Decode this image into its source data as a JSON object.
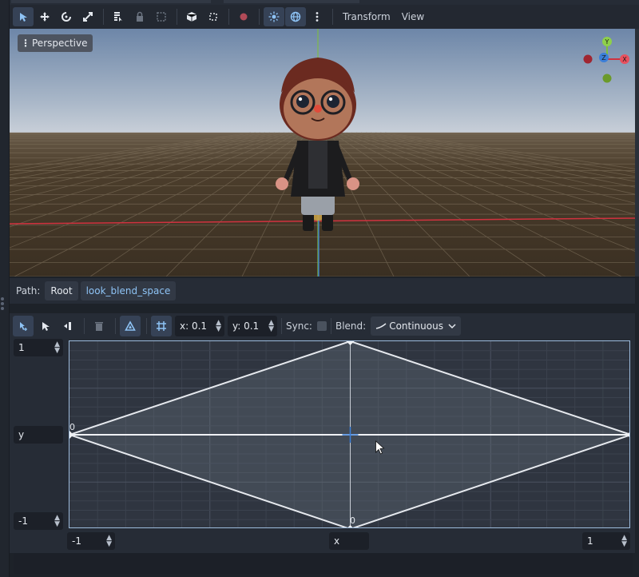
{
  "toolbar": {
    "icons": [
      "select-icon",
      "move-icon",
      "rotate-icon",
      "scale-icon",
      "list-select-icon",
      "lock-icon",
      "group-icon",
      "cube-icon",
      "ruler-icon",
      "pin-icon",
      "sun-icon",
      "globe-icon",
      "more-icon"
    ],
    "transform_menu": "Transform",
    "view_menu": "View"
  },
  "viewport": {
    "perspective_label": "Perspective",
    "gizmo": {
      "y": "Y",
      "z": "Z",
      "x": "X"
    },
    "colors": {
      "sky_top": "#6d86a8",
      "sky_horizon": "#c8cfd8",
      "ground": "#3a2f22",
      "x_axis": "#d0323f",
      "y_axis": "#7fbf3a",
      "z_axis": "#3b7fd9"
    }
  },
  "path_bar": {
    "label": "Path:",
    "items": [
      "Root",
      "look_blend_space"
    ]
  },
  "blend_toolbar": {
    "icons": [
      "create-point-icon",
      "select-icon",
      "add-point-icon",
      "delete-icon",
      "triangle-icon",
      "snap-grid-icon"
    ],
    "x_snap": "x: 0.1",
    "y_snap": "y: 0.1",
    "sync_label": "Sync:",
    "blend_label": "Blend:",
    "blend_mode": "Continuous"
  },
  "blend_space": {
    "y_max": "1",
    "y_label": "y",
    "y_min": "-1",
    "x_min": "-1",
    "x_label": "x",
    "x_max": "1",
    "point_labels": [
      "0",
      "0"
    ]
  },
  "colors": {
    "accent": "#8ec3f5",
    "panel": "#262c36",
    "field": "#1c2028"
  }
}
